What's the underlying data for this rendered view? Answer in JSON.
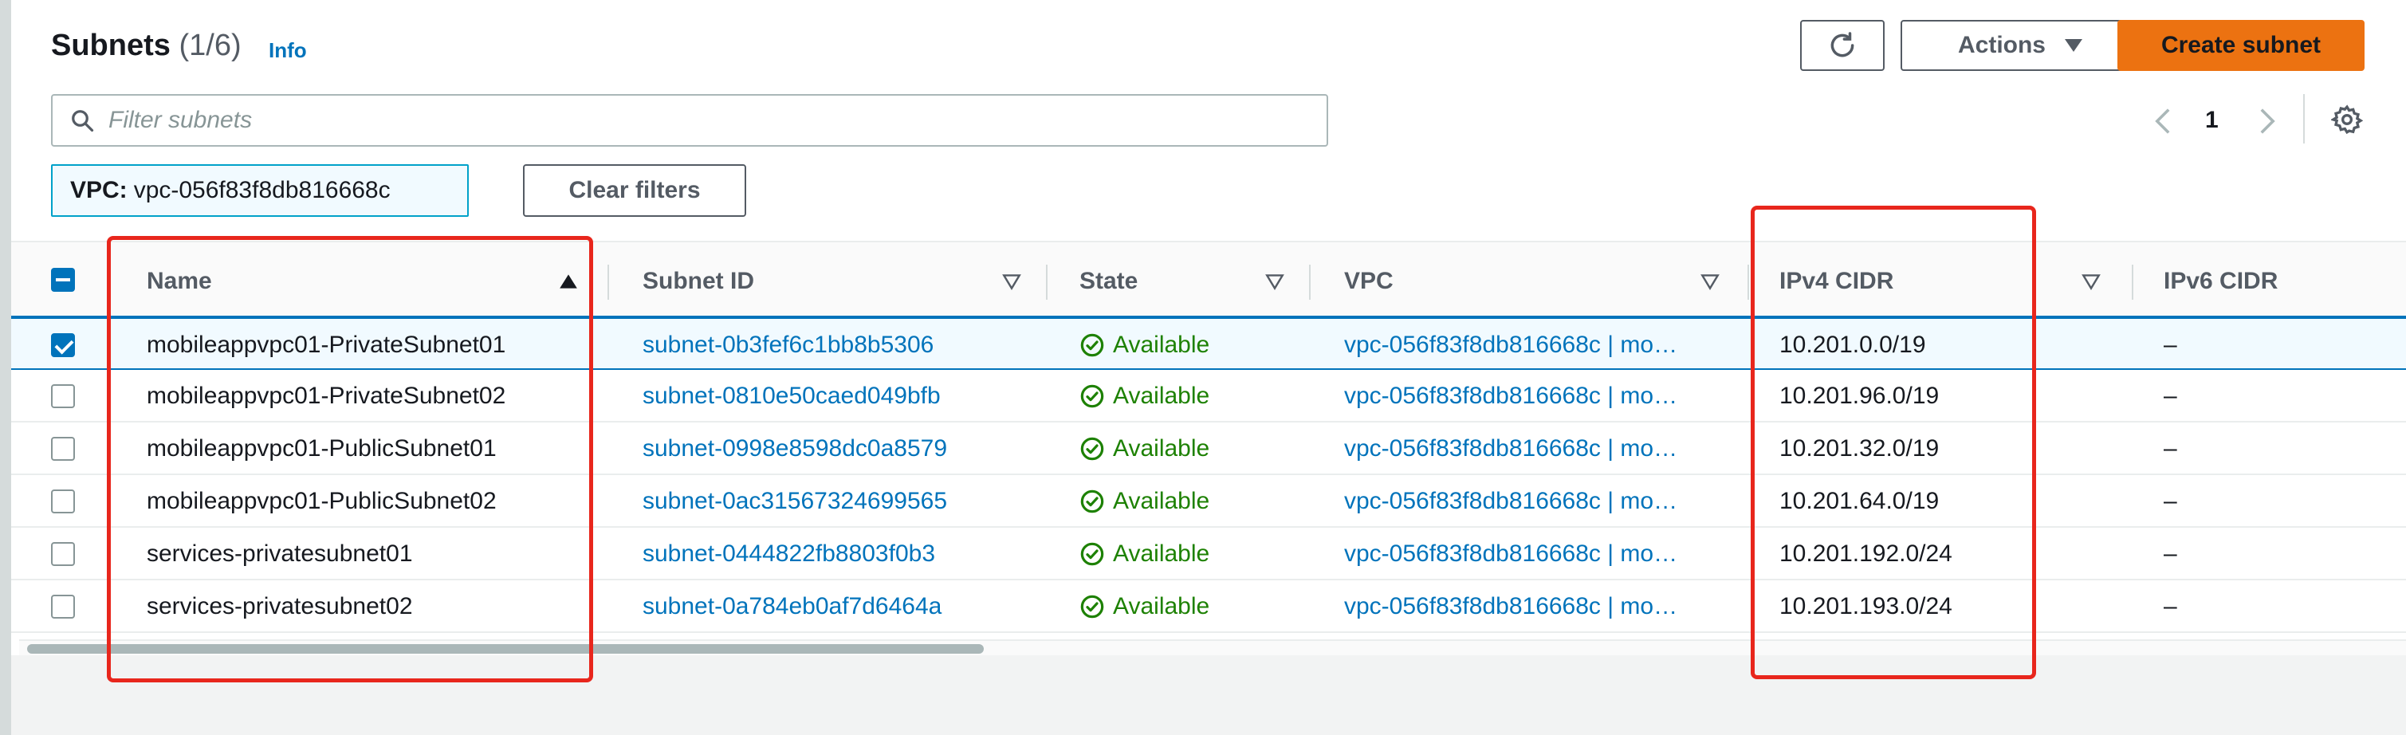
{
  "header": {
    "title": "Subnets",
    "count": "(1/6)",
    "info": "Info",
    "refresh_icon": "refresh-icon",
    "actions_label": "Actions",
    "create_label": "Create subnet"
  },
  "filter": {
    "placeholder": "Filter subnets",
    "value": ""
  },
  "pagination": {
    "page": "1"
  },
  "token": {
    "key": "VPC:",
    "value": "vpc-056f83f8db816668c"
  },
  "clear_filters_label": "Clear filters",
  "table": {
    "columns": {
      "name": "Name",
      "subnet_id": "Subnet ID",
      "state": "State",
      "vpc": "VPC",
      "ipv4": "IPv4 CIDR",
      "ipv6": "IPv6 CIDR"
    },
    "sort": {
      "column": "Name",
      "direction": "ascending"
    },
    "rows": [
      {
        "selected": true,
        "name": "mobileappvpc01-PrivateSubnet01",
        "subnet_id": "subnet-0b3fef6c1bb8b5306",
        "state": "Available",
        "vpc": "vpc-056f83f8db816668c | mo…",
        "ipv4": "10.201.0.0/19",
        "ipv6": "–"
      },
      {
        "selected": false,
        "name": "mobileappvpc01-PrivateSubnet02",
        "subnet_id": "subnet-0810e50caed049bfb",
        "state": "Available",
        "vpc": "vpc-056f83f8db816668c | mo…",
        "ipv4": "10.201.96.0/19",
        "ipv6": "–"
      },
      {
        "selected": false,
        "name": "mobileappvpc01-PublicSubnet01",
        "subnet_id": "subnet-0998e8598dc0a8579",
        "state": "Available",
        "vpc": "vpc-056f83f8db816668c | mo…",
        "ipv4": "10.201.32.0/19",
        "ipv6": "–"
      },
      {
        "selected": false,
        "name": "mobileappvpc01-PublicSubnet02",
        "subnet_id": "subnet-0ac31567324699565",
        "state": "Available",
        "vpc": "vpc-056f83f8db816668c | mo…",
        "ipv4": "10.201.64.0/19",
        "ipv6": "–"
      },
      {
        "selected": false,
        "name": "services-privatesubnet01",
        "subnet_id": "subnet-0444822fb8803f0b3",
        "state": "Available",
        "vpc": "vpc-056f83f8db816668c | mo…",
        "ipv4": "10.201.192.0/24",
        "ipv6": "–"
      },
      {
        "selected": false,
        "name": "services-privatesubnet02",
        "subnet_id": "subnet-0a784eb0af7d6464a",
        "state": "Available",
        "vpc": "vpc-056f83f8db816668c | mo…",
        "ipv4": "10.201.193.0/24",
        "ipv6": "–"
      }
    ]
  },
  "colors": {
    "primary": "#ec7211",
    "link": "#0073bb",
    "success": "#1d8102",
    "annotation": "#e8261c"
  }
}
